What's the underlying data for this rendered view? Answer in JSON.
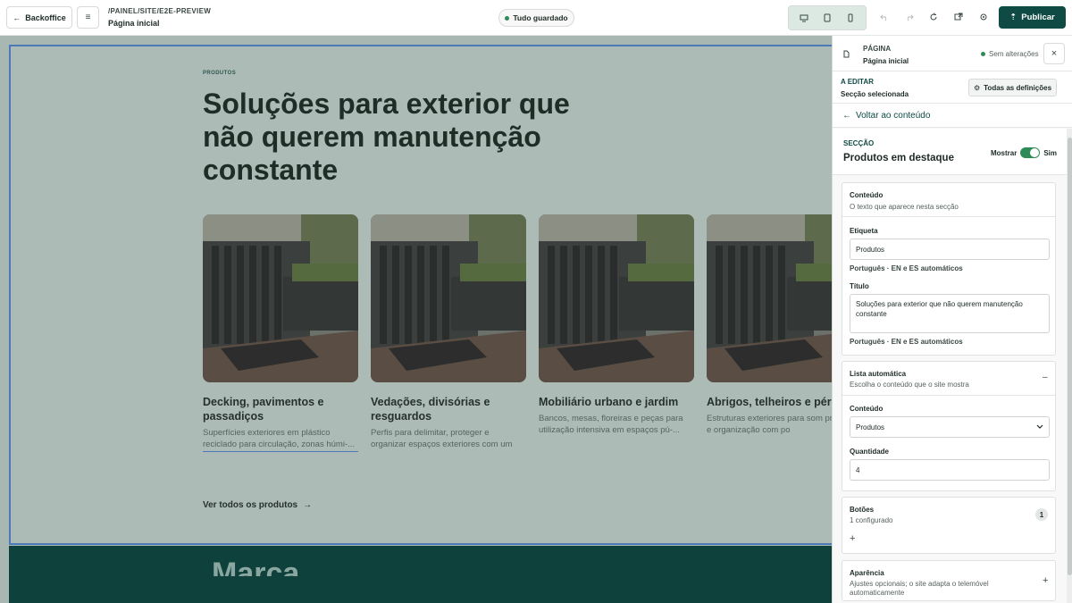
{
  "topbar": {
    "back_label": "Backoffice",
    "path": "/PAINEL/SITE/E2E-PREVIEW",
    "page_name": "Página inicial",
    "save_status": "Tudo guardado",
    "publish_label": "Publicar"
  },
  "preview": {
    "label": "PRODUTOS",
    "title": "Soluções para exterior que não querem manutenção constante",
    "cards": [
      {
        "title": "Decking, pavimentos e passadiços",
        "desc": "Superfícies exteriores em plástico reciclado para circulação, zonas húmi-..."
      },
      {
        "title": "Vedações, divisórias e resguardos",
        "desc": "Perfis para delimitar, proteger e organizar espaços exteriores com um m..."
      },
      {
        "title": "Mobiliário urbano e jardim",
        "desc": "Bancos, mesas, floreiras e peças para utilização intensiva em espaços pú-..."
      },
      {
        "title": "Abrigos, telheiros e pérgolas",
        "desc": "Estruturas exteriores para som proteção e organização com po"
      }
    ],
    "see_all": "Ver todos os produtos",
    "next_section_title": "Marca"
  },
  "panel": {
    "kicker": "PÁGINA",
    "page_name": "Página inicial",
    "status": "Sem alterações",
    "editing_kicker": "A EDITAR",
    "editing_sub": "Secção selecionada",
    "all_settings": "Todas as definições",
    "back_to_content": "Voltar ao conteúdo",
    "section_kicker": "SECÇÃO",
    "section_title": "Produtos em destaque",
    "show_label": "Mostrar",
    "show_value": "Sim",
    "content_box": {
      "title": "Conteúdo",
      "subtitle": "O texto que aparece nesta secção",
      "label_field": "Etiqueta",
      "label_value": "Produtos",
      "lang_hint": "Português · EN e ES automáticos",
      "title_field": "Título",
      "title_value": "Soluções para exterior que não querem manutenção constante"
    },
    "auto_list": {
      "title": "Lista automática",
      "subtitle": "Escolha o conteúdo que o site mostra",
      "content_field": "Conteúdo",
      "content_value": "Produtos",
      "quantity_field": "Quantidade",
      "quantity_value": "4"
    },
    "buttons_box": {
      "title": "Botões",
      "subtitle": "1 configurado",
      "count": "1"
    },
    "appearance_box": {
      "title": "Aparência",
      "subtitle": "Ajustes opcionais; o site adapta o telemóvel automaticamente"
    }
  }
}
